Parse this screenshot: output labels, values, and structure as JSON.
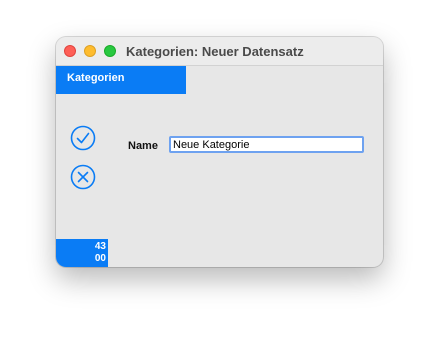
{
  "window": {
    "title": "Kategorien: Neuer Datensatz"
  },
  "tabs": [
    {
      "label": "Kategorien",
      "active": true
    }
  ],
  "actions": {
    "confirm_icon": "checkmark-circle-icon",
    "cancel_icon": "x-circle-icon"
  },
  "form": {
    "name_label": "Name",
    "name_value": "Neue Kategorie"
  },
  "counter": {
    "line1": "43",
    "line2": "00"
  },
  "colors": {
    "accent": "#0a7cf5",
    "window_bg": "#e7e7e7",
    "input_focus": "#6ea2f0"
  }
}
